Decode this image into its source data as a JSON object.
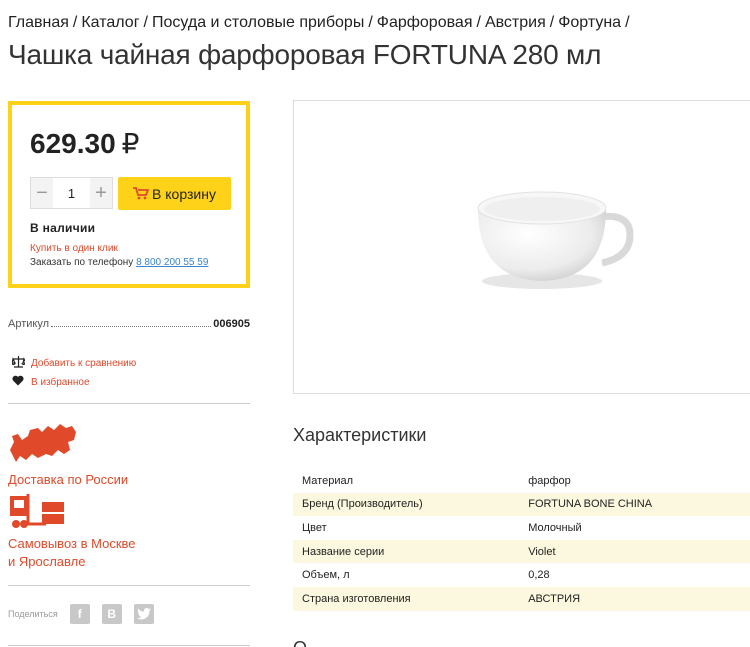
{
  "breadcrumb": [
    "Главная",
    "Каталог",
    "Посуда и столовые приборы",
    "Фарфоровая",
    "Австрия",
    "Фортуна"
  ],
  "breadcrumb_separator": "/",
  "title": "Чашка чайная фарфоровая FORTUNA 280 мл",
  "buy": {
    "price": "629.30",
    "currency": "₽",
    "qty_minus": "−",
    "qty_value": "1",
    "qty_plus": "+",
    "cart_label": "В корзину",
    "in_stock": "В наличии",
    "one_click": "Купить в один клик",
    "phone_label": "Заказать по телефону",
    "phone": "8 800 200 55 59"
  },
  "sku": {
    "label": "Артикул",
    "code": "006905"
  },
  "actions": {
    "compare": "Добавить к сравнению",
    "favorite": "В избранное"
  },
  "promos": {
    "delivery": "Доставка по России",
    "pickup_line1": "Самовывоз в Москве",
    "pickup_line2": "и Ярославле"
  },
  "share": {
    "label": "Поделиться",
    "networks": [
      "f",
      "B"
    ]
  },
  "specs": {
    "title": "Характеристики",
    "rows": [
      [
        "Материал",
        "фарфор"
      ],
      [
        "Бренд (Производитель)",
        "FORTUNA BONE CHINA"
      ],
      [
        "Цвет",
        "Молочный"
      ],
      [
        "Название серии",
        "Violet"
      ],
      [
        "Объем, л",
        "0,28"
      ],
      [
        "Страна изготовления",
        "АВСТРИЯ"
      ]
    ]
  },
  "next_heading": "О",
  "colors": {
    "accent_yellow": "#ffd21a",
    "accent_red": "#e0492a",
    "link_blue": "#3a84c9"
  }
}
